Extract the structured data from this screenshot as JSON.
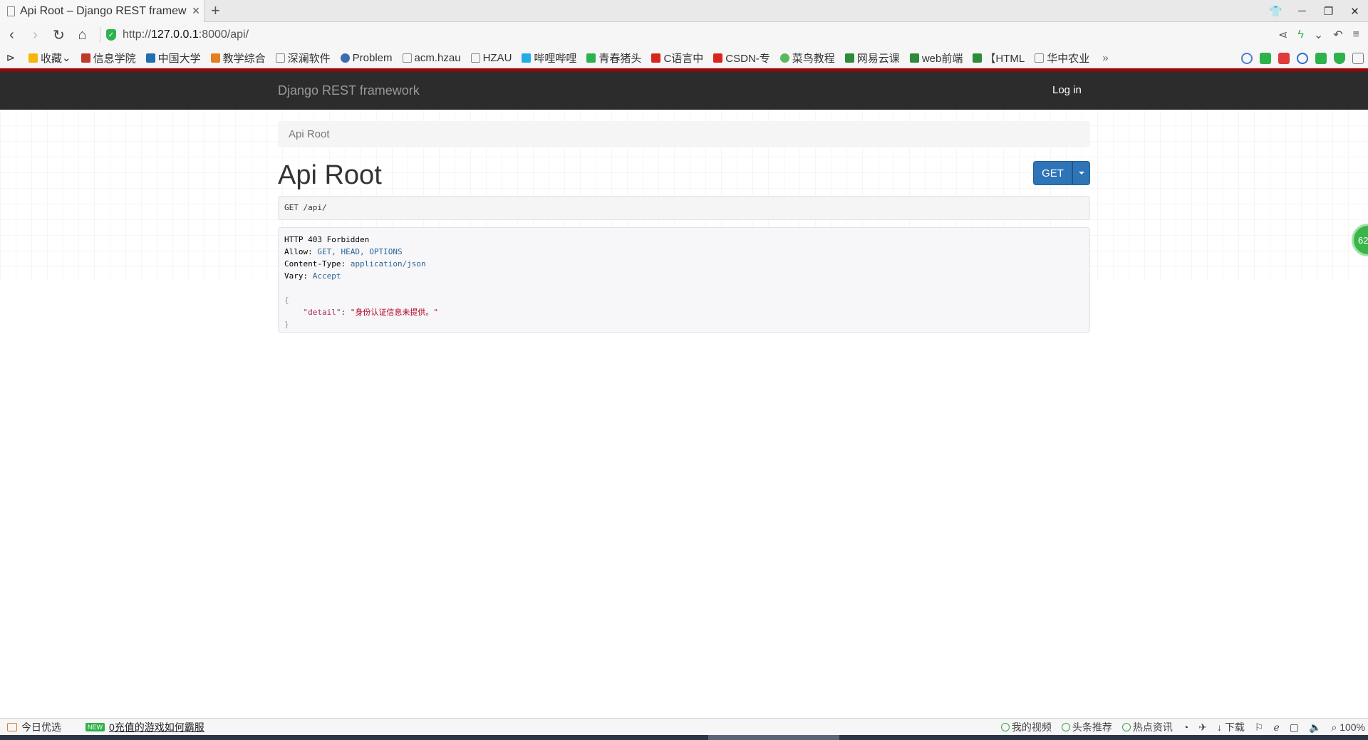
{
  "browser": {
    "tab_title": "Api Root – Django REST framew",
    "new_tab": "+",
    "url_prefix": "http://",
    "url_host": "127.0.0.1",
    "url_rest": ":8000/api/",
    "bookmarks": [
      {
        "label": "收藏",
        "color": "#f5b50a"
      },
      {
        "label": "信息学院",
        "color": "#c0392b"
      },
      {
        "label": "中国大学",
        "color": "#1f6fb2"
      },
      {
        "label": "教学综合",
        "color": "#e67e22"
      },
      {
        "label": "深澜软件",
        "color": "#888888"
      },
      {
        "label": "Problem",
        "color": "#3b6db3"
      },
      {
        "label": "acm.hzau",
        "color": "#888888"
      },
      {
        "label": "HZAU",
        "color": "#888888"
      },
      {
        "label": "哔哩哔哩",
        "color": "#23ade5"
      },
      {
        "label": "青春猪头",
        "color": "#2eb24b"
      },
      {
        "label": "C语言中",
        "color": "#d9261c"
      },
      {
        "label": "CSDN-专",
        "color": "#d9261c"
      },
      {
        "label": "菜鸟教程",
        "color": "#5cb85c"
      },
      {
        "label": "网易云课",
        "color": "#2e8b3a"
      },
      {
        "label": "web前端",
        "color": "#2e8b3a"
      },
      {
        "label": "【HTML",
        "color": "#2e8b3a"
      },
      {
        "label": "华中农业",
        "color": "#888888"
      }
    ],
    "more": "»"
  },
  "drf": {
    "brand": "Django REST framework",
    "login": "Log in",
    "breadcrumb": "Api Root",
    "title": "Api Root",
    "get_button": "GET",
    "request_line": "GET /api/",
    "response": {
      "status": "HTTP 403 Forbidden",
      "allow_key": "Allow:",
      "allow_val": "GET, HEAD, OPTIONS",
      "ctype_key": "Content-Type:",
      "ctype_val": "application/json",
      "vary_key": "Vary:",
      "vary_val": "Accept",
      "open_brace": "{",
      "json_key": "\"detail\"",
      "json_sep": ": ",
      "json_val": "\"身份认证信息未提供。\"",
      "close_brace": "}"
    }
  },
  "float_ball": "62",
  "statusbar": {
    "today": "今日优选",
    "new": "NEW",
    "news": "0充值的游戏如何霸服",
    "items": [
      "我的视频",
      "头条推荐",
      "热点资讯"
    ],
    "download": "下载",
    "zoom": "100%"
  }
}
